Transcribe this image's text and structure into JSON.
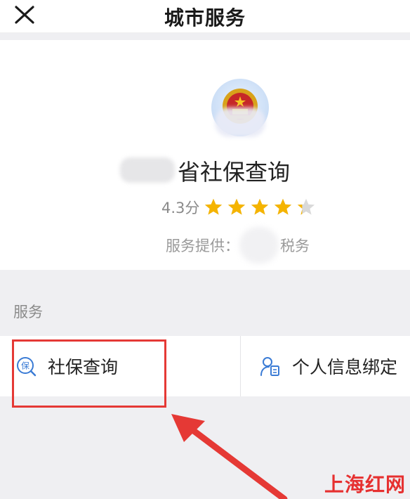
{
  "header": {
    "title": "城市服务",
    "close_icon": "close-icon"
  },
  "app": {
    "name": "省社保查询",
    "rating_score": "4.3分",
    "rating_value": 4.3,
    "rating_max": 5,
    "provider_label": "服务提供：",
    "provider_suffix": "税务",
    "emblem_icon": "national-emblem-icon"
  },
  "services_section": {
    "label": "服务",
    "items": [
      {
        "label": "社保查询",
        "icon": "social-security-icon"
      },
      {
        "label": "个人信息绑定",
        "icon": "person-card-icon"
      }
    ]
  },
  "annotations": {
    "highlight_color": "#e53935"
  },
  "watermark": "上海红网",
  "colors": {
    "star": "#f5b400",
    "star_empty": "#d9d9d9",
    "icon_blue": "#3a7bd5",
    "page_bg": "#efeff2"
  }
}
